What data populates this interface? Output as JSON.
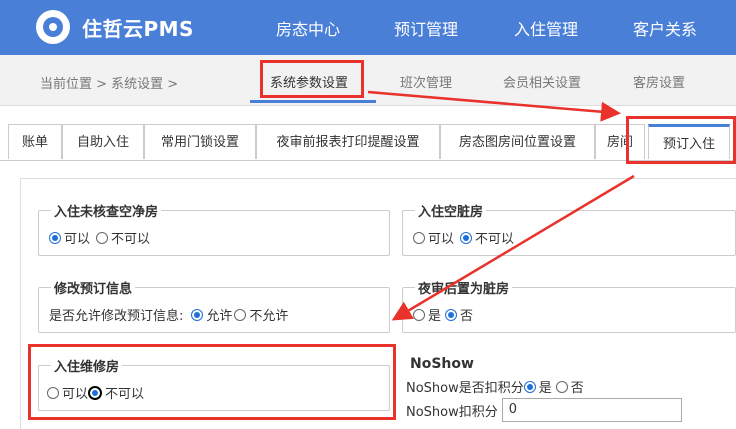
{
  "header": {
    "brand": "住哲云PMS",
    "nav": [
      "房态中心",
      "预订管理",
      "入住管理",
      "客户关系"
    ]
  },
  "breadcrumb": {
    "text": "当前位置 > 系统设置 >",
    "tabs": [
      "系统参数设置",
      "班次管理",
      "会员相关设置",
      "客房设置"
    ],
    "active": "系统参数设置"
  },
  "subtabs": {
    "items": [
      "账单",
      "自助入住",
      "常用门锁设置",
      "夜审前报表打印提醒设置",
      "房态图房间位置设置",
      "房间",
      "预订入住"
    ],
    "active": "预订入住"
  },
  "settings": {
    "unchecked_clean": {
      "title": "入住未核查空净房",
      "opt_yes": "可以",
      "opt_no": "不可以",
      "selected": "可以"
    },
    "empty_dirty": {
      "title": "入住空脏房",
      "opt_yes": "可以",
      "opt_no": "不可以",
      "selected": "不可以"
    },
    "modify_booking": {
      "title": "修改预订信息",
      "question": "是否允许修改预订信息:",
      "opt_yes": "允许",
      "opt_no": "不允许",
      "selected": "允许"
    },
    "night_audit_dirty": {
      "title": "夜审后置为脏房",
      "opt_yes": "是",
      "opt_no": "否",
      "selected": "否"
    },
    "checkin_maintenance": {
      "title": "入住维修房",
      "opt_yes": "可以",
      "opt_no": "不可以",
      "selected": "不可以"
    },
    "noshow": {
      "title": "NoShow",
      "deduct_label": "NoShow是否扣积分",
      "opt_yes": "是",
      "opt_no": "否",
      "selected": "是",
      "points_label": "NoShow扣积分",
      "points_value": "0"
    }
  },
  "colors": {
    "primary": "#4a7fd8",
    "annotation": "#e8322b",
    "radio": "#1e6fd9"
  }
}
